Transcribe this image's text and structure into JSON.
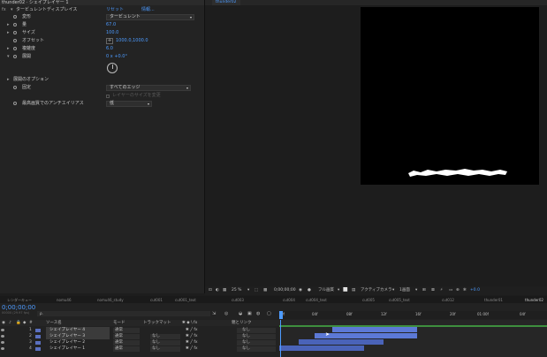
{
  "effects": {
    "header": "thunder02 · シェイプレイヤー 1",
    "fx_name": "タービュレントディスプレイス",
    "fx_reset": "リセット",
    "fx_about": "情報...",
    "props": [
      {
        "label": "変形",
        "value": "タービュレント"
      },
      {
        "label": "量",
        "value": "67.0"
      },
      {
        "label": "サイズ",
        "value": "100.0"
      },
      {
        "label": "オフセット",
        "value": "1000.0,1000.0"
      },
      {
        "label": "複雑度",
        "value": "6.0"
      },
      {
        "label": "展開",
        "value": "0 x +0.0°"
      }
    ],
    "options_label": "展開のオプション",
    "fix_label": "固定",
    "fix_value": "すべてのエッジ",
    "resize_label": "レイヤーのサイズを変更",
    "aa_label": "最高画質でのアンチエイリアス",
    "aa_value": "低"
  },
  "viewer": {
    "tab": "thunder02",
    "zoom": "25 %",
    "timecode": "0;00;00;00",
    "quality": "フル画質",
    "camera": "アクティブカメラ",
    "views": "1画面",
    "exposure": "+0.0"
  },
  "timeline": {
    "tabs": [
      "レンダーキュー",
      "nomu46",
      "nomu46_study",
      "cut001",
      "cut001_text",
      "cut003",
      "cut004",
      "cut004_text",
      "cut005",
      "cut005_text",
      "cut012",
      "thunder01",
      "thunder02"
    ],
    "time": "0;00;00;00",
    "fps": "00000 (29.97 fps)",
    "search_placeholder": "ρ.",
    "headers": {
      "source": "ソース名",
      "mode": "モード",
      "trkmat": "トラックマット",
      "parent": "親とリンク"
    },
    "ruler": [
      "0f",
      "04f",
      "08f",
      "12f",
      "16f",
      "20f",
      "01:00f",
      "04f"
    ],
    "layers": [
      {
        "num": "1",
        "name": "シェイプレイヤー 4",
        "mode": "通常",
        "trkmat": "",
        "parent": "なし"
      },
      {
        "num": "2",
        "name": "シェイプレイヤー 3",
        "mode": "通常",
        "trkmat": "なし",
        "parent": "なし"
      },
      {
        "num": "3",
        "name": "シェイプレイヤー 2",
        "mode": "通常",
        "trkmat": "なし",
        "parent": "なし"
      },
      {
        "num": "4",
        "name": "シェイプレイヤー 1",
        "mode": "通常",
        "trkmat": "なし",
        "parent": "なし"
      }
    ]
  },
  "colors": {
    "accent": "#4d9bff",
    "bar": "#5c79d6",
    "label": "#5a6fbf"
  }
}
